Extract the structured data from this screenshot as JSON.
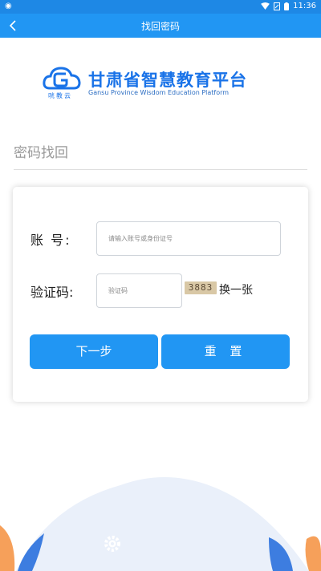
{
  "status_bar": {
    "time": "11:36",
    "icons": [
      "notification-icon",
      "wifi-icon",
      "signal-icon",
      "battery-icon"
    ]
  },
  "nav": {
    "title": "找回密码",
    "back_icon": "chevron-left-icon"
  },
  "logo": {
    "brand_sub": "咣教云",
    "name_cn": "甘肃省智慧教育平台",
    "name_en": "Gansu Province Wisdom Education Platform"
  },
  "section": {
    "title": "密码找回"
  },
  "form": {
    "account_label": "账 号:",
    "account_placeholder": "请输入账号或身份证号",
    "captcha_label": "验证码:",
    "captcha_placeholder": "验证码",
    "captcha_text": "3883",
    "refresh_label": "换一张",
    "next_label": "下一步",
    "reset_label": "重 置"
  },
  "colors": {
    "primary": "#2196f3",
    "status": "#1e88e5",
    "logo": "#1a73e8"
  }
}
